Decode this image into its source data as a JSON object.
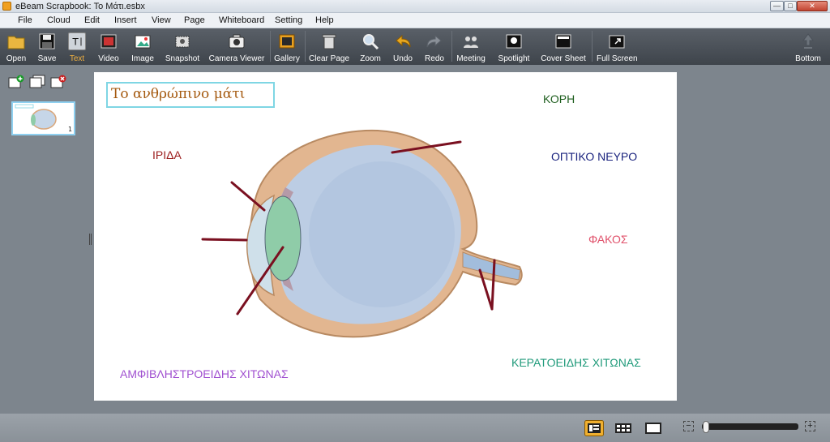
{
  "window": {
    "title": "eBeam Scrapbook: Το Μάτι.esbx",
    "minimize_glyph": "—",
    "maximize_glyph": "□",
    "close_glyph": "✕"
  },
  "menu": [
    "File",
    "Cloud",
    "Edit",
    "Insert",
    "View",
    "Page",
    "Whiteboard",
    "Setting",
    "Help"
  ],
  "toolbar": {
    "open": "Open",
    "save": "Save",
    "text": "Text",
    "video": "Video",
    "image": "Image",
    "snapshot": "Snapshot",
    "camera_viewer": "Camera Viewer",
    "gallery": "Gallery",
    "clear_page": "Clear Page",
    "zoom": "Zoom",
    "undo": "Undo",
    "redo": "Redo",
    "meeting": "Meeting",
    "spotlight": "Spotlight",
    "cover_sheet": "Cover Sheet",
    "full_screen": "Full Screen",
    "bottom": "Bottom",
    "active_tool": "Text"
  },
  "page_panel": {
    "thumbnail_page_number": "1"
  },
  "canvas": {
    "title": "Το ανθρώπινο μάτι",
    "labels": {
      "kori": "ΚΟΡΗ",
      "iris": "ΙΡΙΔΑ",
      "optic_nerve": "ΟΠΤΙΚΟ ΝΕΥΡΟ",
      "lens": "ΦΑΚΟΣ",
      "cornea": "ΚΕΡΑΤΟΕΙΔΗΣ ΧΙΤΩΝΑΣ",
      "choroid": "ΑΜΦΙΒΛΗΣΤΡΟΕΙΔΗΣ ΧΙΤΩΝΑΣ"
    },
    "colors": {
      "title": "#a55a10",
      "kori": "#1f5f1f",
      "iris": "#9b1d1d",
      "optic_nerve": "#1a237e",
      "lens": "#e0506a",
      "cornea": "#1f9a7a",
      "choroid": "#a050d0",
      "annotation_lines": "#7a1020"
    }
  },
  "zoom": {
    "level": 0.03,
    "minus": "−",
    "plus": "+"
  }
}
